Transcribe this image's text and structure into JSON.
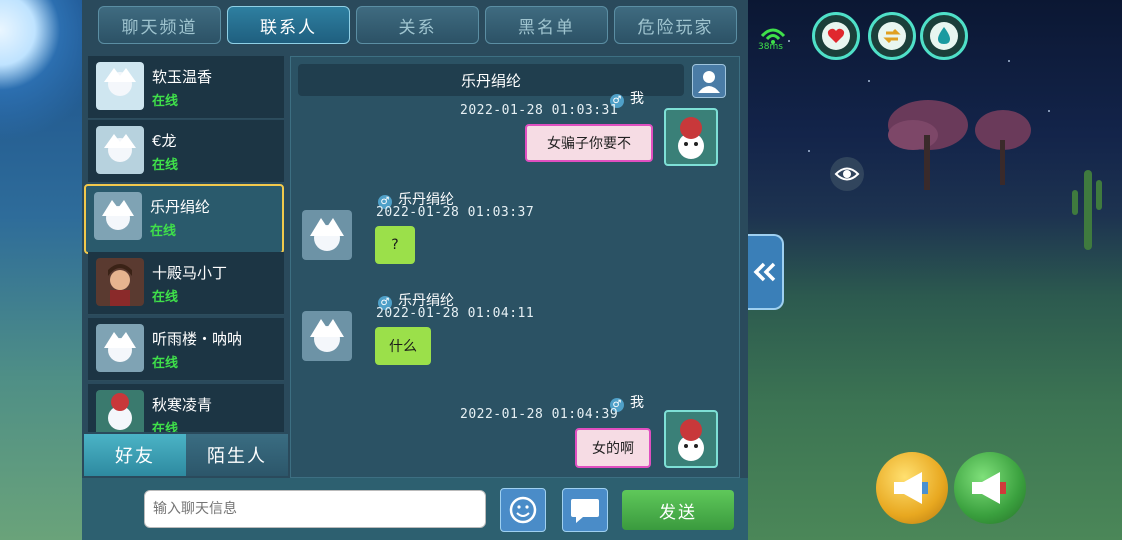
{
  "tabs": [
    {
      "label": "聊天频道",
      "active": false
    },
    {
      "label": "联系人",
      "active": true
    },
    {
      "label": "关系",
      "active": false
    },
    {
      "label": "黑名单",
      "active": false
    },
    {
      "label": "危险玩家",
      "active": false
    }
  ],
  "contacts": [
    {
      "name": "软玉温香",
      "status": "在线",
      "selected": false
    },
    {
      "name": "€龙",
      "status": "在线",
      "selected": false
    },
    {
      "name": "乐丹绢纶",
      "status": "在线",
      "selected": true
    },
    {
      "name": "十殿马小丁",
      "status": "在线",
      "selected": false
    },
    {
      "name": "听雨楼・呐呐",
      "status": "在线",
      "selected": false
    },
    {
      "name": "秋寒凌青",
      "status": "在线",
      "selected": false
    }
  ],
  "bottom_tabs": {
    "friends": "好友",
    "strangers": "陌生人"
  },
  "chat": {
    "partner_name": "乐丹绢纶",
    "messages": [
      {
        "from": "me",
        "sender": "我",
        "time": "2022-01-28  01:03:31",
        "text": "女骗子你要不"
      },
      {
        "from": "other",
        "sender": "乐丹绢纶",
        "time": "2022-01-28  01:03:37",
        "text": "?"
      },
      {
        "from": "other",
        "sender": "乐丹绢纶",
        "time": "2022-01-28  01:04:11",
        "text": "什么"
      },
      {
        "from": "me",
        "sender": "我",
        "time": "2022-01-28  01:04:39",
        "text": "女的啊"
      }
    ]
  },
  "input": {
    "placeholder": "输入聊天信息"
  },
  "send_label": "发送",
  "hud": {
    "ping": "38ms",
    "heart_icon": "heart-icon",
    "swap_icon": "swap-icon",
    "drop_icon": "water-drop-icon"
  },
  "colors": {
    "online": "#3fe04a",
    "selected_border": "#f2c94c",
    "send": "#4fb44c",
    "my_bubble_border": "#e04fc0",
    "other_bubble": "#9be04a"
  }
}
